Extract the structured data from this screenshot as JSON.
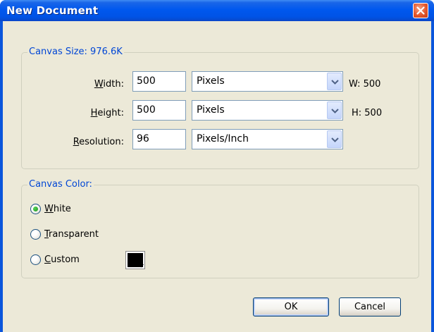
{
  "window": {
    "title": "New Document"
  },
  "canvas_size": {
    "group_label": "Canvas Size: 976.6K",
    "width": {
      "label_accel": "W",
      "label_rest": "idth:",
      "value": "500",
      "unit": "Pixels",
      "readout": "W: 500"
    },
    "height": {
      "label_accel": "H",
      "label_rest": "eight:",
      "value": "500",
      "unit": "Pixels",
      "readout": "H: 500"
    },
    "resolution": {
      "label_accel": "R",
      "label_rest": "esolution:",
      "value": "96",
      "unit": "Pixels/Inch"
    }
  },
  "canvas_color": {
    "group_label": "Canvas Color:",
    "options": [
      {
        "accel": "W",
        "rest": "hite",
        "selected": true
      },
      {
        "accel": "T",
        "rest": "ransparent",
        "selected": false
      },
      {
        "accel": "C",
        "rest": "ustom",
        "selected": false
      }
    ],
    "custom_color": "#000000"
  },
  "buttons": {
    "ok": "OK",
    "cancel": "Cancel"
  },
  "colors": {
    "titlebar": "#0058ee",
    "dialog_bg": "#ece9d8",
    "group_label": "#0046d5",
    "close_button": "#e4572c"
  }
}
